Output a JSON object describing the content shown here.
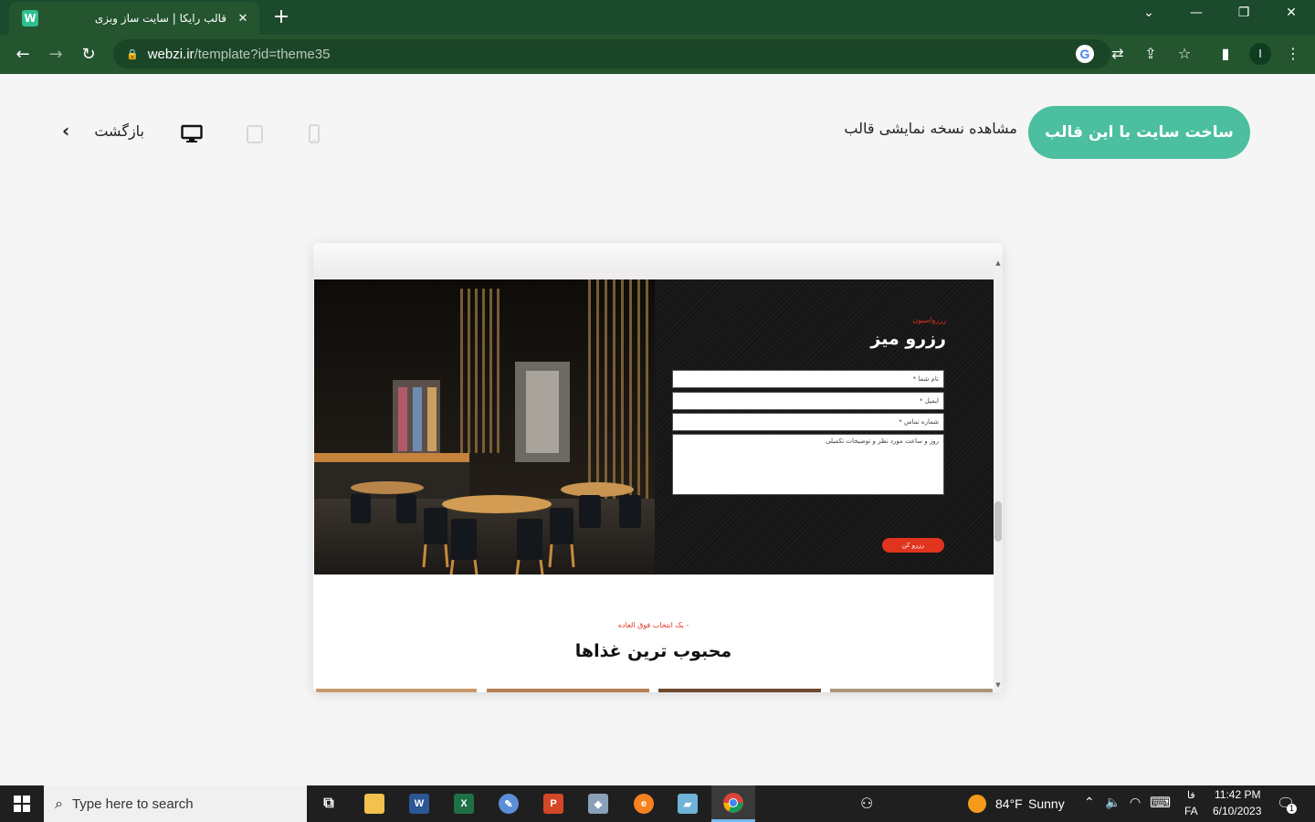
{
  "browser": {
    "tab_title": "قالب رایکا | سایت ساز وبزی",
    "favicon_letter": "W",
    "url_domain": "webzi.ir",
    "url_path": "/template?id=theme35",
    "profile_initial": "I"
  },
  "page": {
    "cta_label": "ساخت سایت با این قالب",
    "demo_label": "مشاهده نسخه نمایشی قالب",
    "back_label": "بازگشت",
    "devices": [
      "desktop-icon",
      "tablet-icon",
      "mobile-icon"
    ],
    "selected_device": "desktop"
  },
  "preview": {
    "reservation_subtitle": "رزرواسیون",
    "reservation_title": "رزرو میز",
    "fields": {
      "name": "نام شما *",
      "email": "ایمیل *",
      "phone": "شماره تماس *",
      "details": "روز و ساعت مورد نظر و توضیحات تکمیلی"
    },
    "submit_label": "رزرو کن",
    "dishes_subtitle": "- یک انتخاب فوق العاده",
    "dishes_title": "محبوب ترین غذاها"
  },
  "taskbar": {
    "search_placeholder": "Type here to search",
    "weather_temp": "84°F",
    "weather_desc": "Sunny",
    "lang_top": "فا",
    "lang_bottom": "FA",
    "time": "11:42 PM",
    "date": "6/10/2023",
    "notification_count": "1"
  },
  "colors": {
    "accent": "#4bbf9f",
    "chrome_dark": "#1b4a2c",
    "chrome_toolbar": "#24552f",
    "reserve_red": "#e0341e"
  }
}
